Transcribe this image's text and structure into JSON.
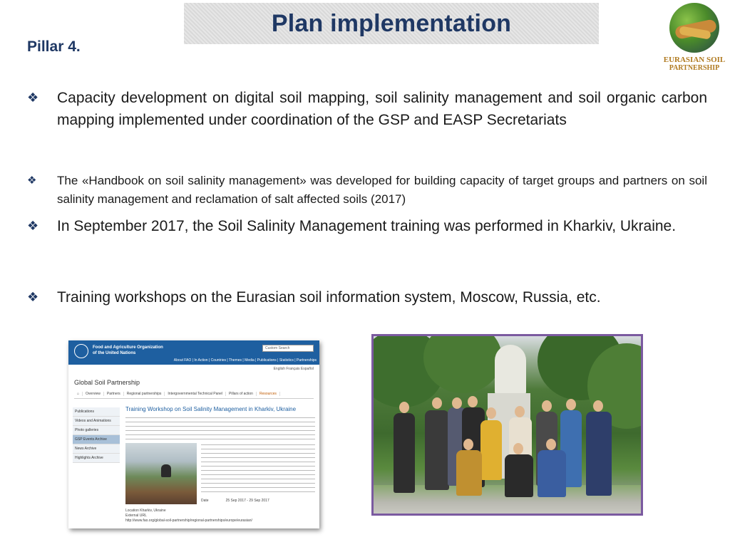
{
  "slide": {
    "title": "Plan implementation",
    "pillar": "Pillar 4."
  },
  "logo": {
    "line1": "EURASIAN SOIL",
    "line2": "PARTNERSHIP"
  },
  "bullets": [
    "Capacity development on digital soil mapping, soil salinity management and soil organic carbon mapping  implemented under coordination of the GSP and EASP Secretariats",
    "The «Handbook on soil salinity management» was  developed for building capacity of target groups and partners on soil salinity management and reclamation of salt affected soils (2017)",
    "In September 2017, the Soil Salinity Management training was performed in Kharkiv, Ukraine.",
    "Training workshops on  the Eurasian soil information system, Moscow, Russia, etc."
  ],
  "bullet_icon": "diamond-bullet-icon",
  "website": {
    "org_line1": "Food and Agriculture Organization",
    "org_line2": "of the United Nations",
    "search_placeholder": "Custom Search",
    "nav": "About FAO | In Action | Countries | Themes | Media | Publications | Statistics | Partnerships",
    "lang": "English   Français   Español",
    "site_title": "Global Soil Partnership",
    "tabs": [
      "Overview",
      "Partners",
      "Regional partnerships",
      "Intergovernmental Technical Panel",
      "Pillars of action",
      "Resources"
    ],
    "side_items": [
      "Publications",
      "Videos and Animations",
      "Photo galleries",
      "GSP Events Archive",
      "News Archive",
      "Highlights Archive"
    ],
    "article_title": "Training Workshop on Soil Salinity Management in Kharkiv, Ukraine",
    "date_label": "Date",
    "date_value": "25 Sep 2017 - 29 Sep 2017",
    "location_line": "Location   Kharkiv, Ukraine",
    "external_label": "External URL",
    "external_url": "http://www.fao.org/global-soil-partnership/regional-partnerships/europe/eurasian/"
  }
}
